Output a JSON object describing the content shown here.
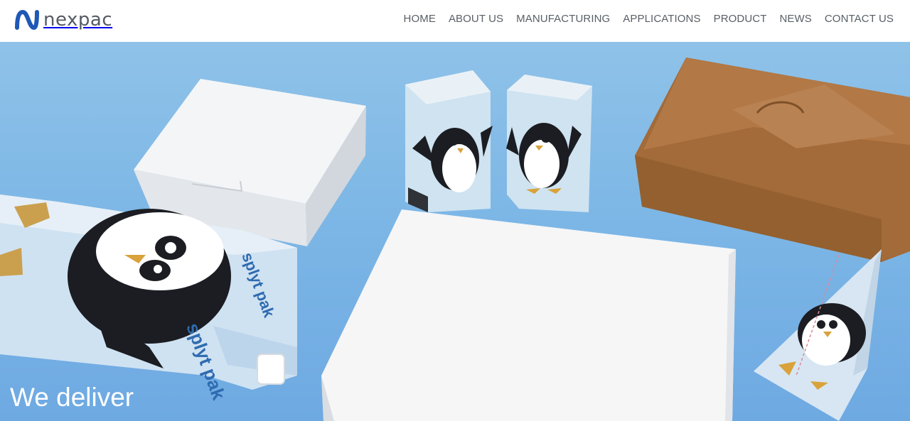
{
  "brand": {
    "name": "nexpac",
    "accent": "#1f58b5"
  },
  "nav": {
    "items": [
      {
        "label": "HOME"
      },
      {
        "label": "ABOUT US"
      },
      {
        "label": "MANUFACTURING"
      },
      {
        "label": "APPLICATIONS"
      },
      {
        "label": "PRODUCT"
      },
      {
        "label": "NEWS"
      },
      {
        "label": "CONTACT US"
      }
    ]
  },
  "hero": {
    "heading_line1": "We deliver",
    "carton_brand": "splyt pak"
  },
  "colors": {
    "hero_background": "#7db7e6",
    "nav_text": "#585f66",
    "kraft_box": "#a36a3a"
  }
}
